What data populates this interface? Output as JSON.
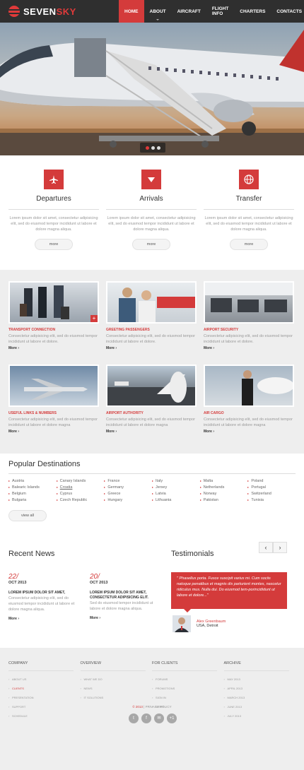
{
  "brand": {
    "part1": "SEVEN",
    "part2": "SKY"
  },
  "nav": [
    {
      "label": "Home",
      "active": true
    },
    {
      "label": "About",
      "caret": true
    },
    {
      "label": "Aircraft"
    },
    {
      "label": "Flight info"
    },
    {
      "label": "Charters"
    },
    {
      "label": "Contacts"
    }
  ],
  "slider": {
    "dots": 3,
    "active": 0
  },
  "services": [
    {
      "title": "Departures",
      "icon": "airplane-icon",
      "text": "Lorem ipsum dolor sit amet, consectetur adipisicing elit, sed do eiusmod tempor incididunt ut labore et dolore magna aliqua.",
      "button": "more"
    },
    {
      "title": "Arrivals",
      "icon": "arrow-down-icon",
      "text": "Lorem ipsum dolor sit amet, consectetur adipisicing elit, sed do eiusmod tempor incididunt ut labore et dolore magna aliqua.",
      "button": "more"
    },
    {
      "title": "Transfer",
      "icon": "globe-icon",
      "text": "Lorem ipsum dolor sit amet, consectetur adipisicing elit, sed do eiusmod tempor incididunt ut labore et dolore magna aliqua.",
      "button": "more"
    }
  ],
  "gallery": [
    {
      "title": "Transport connection",
      "text": "Consectetur adipisicing elit, sed do eiusmod tempor incididunt ut labore et dolore.",
      "more": "More"
    },
    {
      "title": "Greeting passengers",
      "text": "Consectetur adipisicing elit, sed do eiusmod tempor incididunt ut labore et dolore.",
      "more": "More"
    },
    {
      "title": "Airport security",
      "text": "Consectetur adipisicing elit, sed do eiusmod tempor incididunt ut labore et dolore.",
      "more": "More"
    },
    {
      "title": "Useful links & numbers",
      "text": "Consectetur adipisicing elit, sed do eiusmod tempor incididunt ut labore et dolore magna",
      "more": "More"
    },
    {
      "title": "Airport authority",
      "text": "Consectetur adipisicing elit, sed do eiusmod tempor incididunt ut labore et dolore magna",
      "more": "More"
    },
    {
      "title": "Air cargo",
      "text": "Consectetur adipisicing elit, sed do eiusmod tempor incididunt ut labore et dolore magna",
      "more": "More"
    }
  ],
  "destinations": {
    "title": "Popular Destinations",
    "columns": [
      [
        "Austria",
        "Balearic Islands",
        "Belgium",
        "Bulgaria"
      ],
      [
        "Canary Islands",
        "Croatia",
        "Cyprus",
        "Czech Republic"
      ],
      [
        "France",
        "Germany",
        "Greece",
        "Hungary"
      ],
      [
        "Italy",
        "Jersey",
        "Latvia",
        "Lithuania"
      ],
      [
        "Malta",
        "Netherlands",
        "Norway",
        "Pakistan"
      ],
      [
        "Poland",
        "Portugal",
        "Switzerland",
        "Tunisia"
      ]
    ],
    "button": "view all"
  },
  "news": {
    "title": "Recent News",
    "items": [
      {
        "day": "22/",
        "month": "OCT 2013",
        "headline": "LOREM IPSUM DOLOR SIT AMET,",
        "text": "Consectetur adipisicing elit, sed do eiusmod tempor incididunt ut labore et dolore magna aliqua.",
        "more": "More"
      },
      {
        "day": "20/",
        "month": "OCT 2013",
        "headline": "LOREM IPSUM DOLOR SIT AMET, CONSECTETUR ADIPISICING ELIT.",
        "text": "Sed do eiusmod tempor incididunt ut labore et dolore magna aliqua.",
        "more": "More"
      }
    ]
  },
  "testimonials": {
    "title": "Testimonials",
    "quote": "\" Phasellus porta. Fusce suscipit varius mi. Cum sociis natoque penatibus et magnis dis parturient montes, nascetur ridiculus mus. Nulla dui. Do eiusmod tem-porincididunt ut labore et dolore...\"",
    "name": "Alex Greenbaum",
    "city": "USA, Detroit"
  },
  "footer": {
    "columns": [
      {
        "title": "Company",
        "items": [
          "About us",
          "Clients",
          "Presentation",
          "Support",
          "Schedule"
        ]
      },
      {
        "title": "Overview",
        "items": [
          "What we do",
          "News",
          "IT Solutions"
        ]
      },
      {
        "title": "For clients",
        "items": [
          "Forums",
          "Promotions",
          "Sign in",
          "News"
        ]
      },
      {
        "title": "Archive",
        "items": [
          "May 2013",
          "April 2013",
          "March 2013",
          "June 2013",
          "July 2013"
        ]
      }
    ],
    "copyright": "© 2013",
    "policy": "Privacy policy",
    "social": [
      "twitter-icon",
      "facebook-icon",
      "email-icon",
      "google-plus-icon"
    ]
  }
}
